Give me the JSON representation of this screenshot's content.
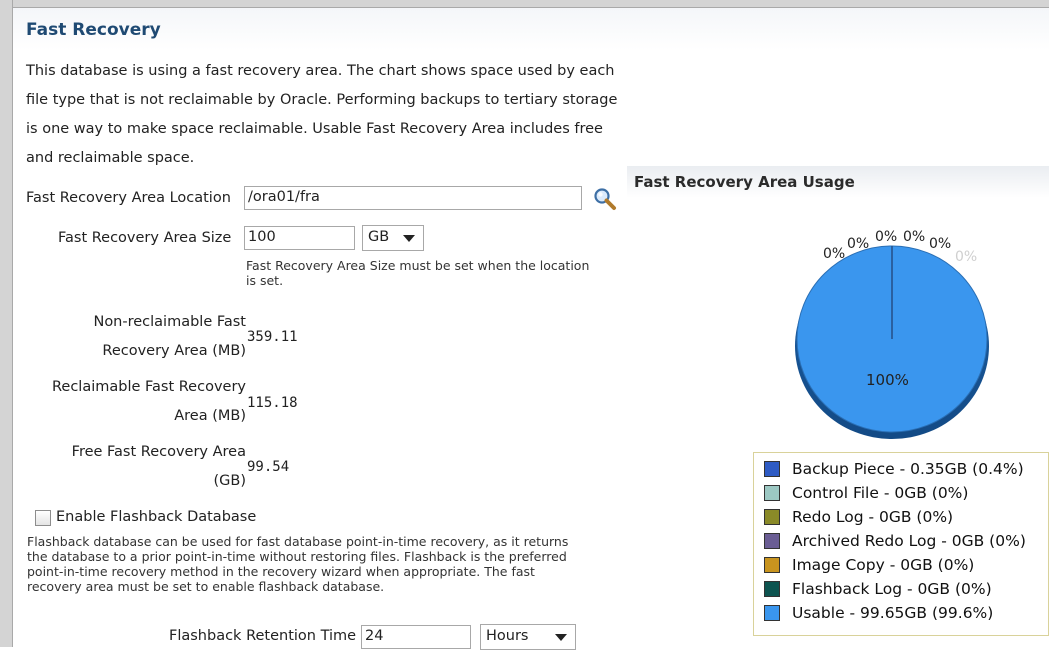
{
  "section": {
    "title": "Fast Recovery",
    "intro_lines": [
      "This database is using a fast recovery area. The chart shows space used by each",
      "file type that is not reclaimable by Oracle. Performing backups to tertiary storage",
      "is one way to make space reclaimable. Usable Fast Recovery Area includes free",
      "and reclaimable space."
    ]
  },
  "form": {
    "location_label": "Fast Recovery Area Location",
    "location_value": "/ora01/fra",
    "size_label": "Fast Recovery Area Size",
    "size_value": "100",
    "size_unit": "GB",
    "size_hint_lines": [
      "Fast Recovery Area Size must be set when the location",
      "is set."
    ],
    "nonreclaimable_label": [
      "Non-reclaimable Fast",
      "Recovery Area (MB)"
    ],
    "nonreclaimable_value": "359.11",
    "reclaimable_label": [
      "Reclaimable Fast Recovery",
      "Area (MB)"
    ],
    "reclaimable_value": "115.18",
    "free_label": [
      "Free Fast Recovery Area",
      "(GB)"
    ],
    "free_value": "99.54",
    "flashback_checkbox_label": "Enable Flashback Database",
    "flashback_checked": false,
    "flashback_desc_lines": [
      "Flashback database can be used for fast database point-in-time recovery, as it returns",
      "the database to a prior point-in-time without restoring files. Flashback is the preferred",
      "point-in-time recovery method in the recovery wizard when appropriate. The fast",
      "recovery area must be set to enable flashback database."
    ],
    "retention_label": "Flashback Retention Time",
    "retention_value": "24",
    "retention_unit": "Hours"
  },
  "usage": {
    "title": "Fast Recovery Area Usage",
    "legend": [
      {
        "label": "Backup Piece - 0.35GB (0.4%)",
        "color": "#2e5bc4"
      },
      {
        "label": "Control File - 0GB (0%)",
        "color": "#9cc8c3"
      },
      {
        "label": "Redo Log - 0GB (0%)",
        "color": "#8a8a28"
      },
      {
        "label": "Archived Redo Log - 0GB (0%)",
        "color": "#6a5d94"
      },
      {
        "label": "Image Copy - 0GB (0%)",
        "color": "#c8941f"
      },
      {
        "label": "Flashback Log - 0GB (0%)",
        "color": "#0d5450"
      },
      {
        "label": "Usable  - 99.65GB (99.6%)",
        "color": "#3a96ee"
      }
    ],
    "pie_labels": [
      "0%",
      "0%",
      "0%",
      "0%",
      "0%",
      "0%",
      "100%"
    ]
  },
  "icons": {
    "search": "search-icon",
    "dropdown": "chevron-down-icon"
  }
}
